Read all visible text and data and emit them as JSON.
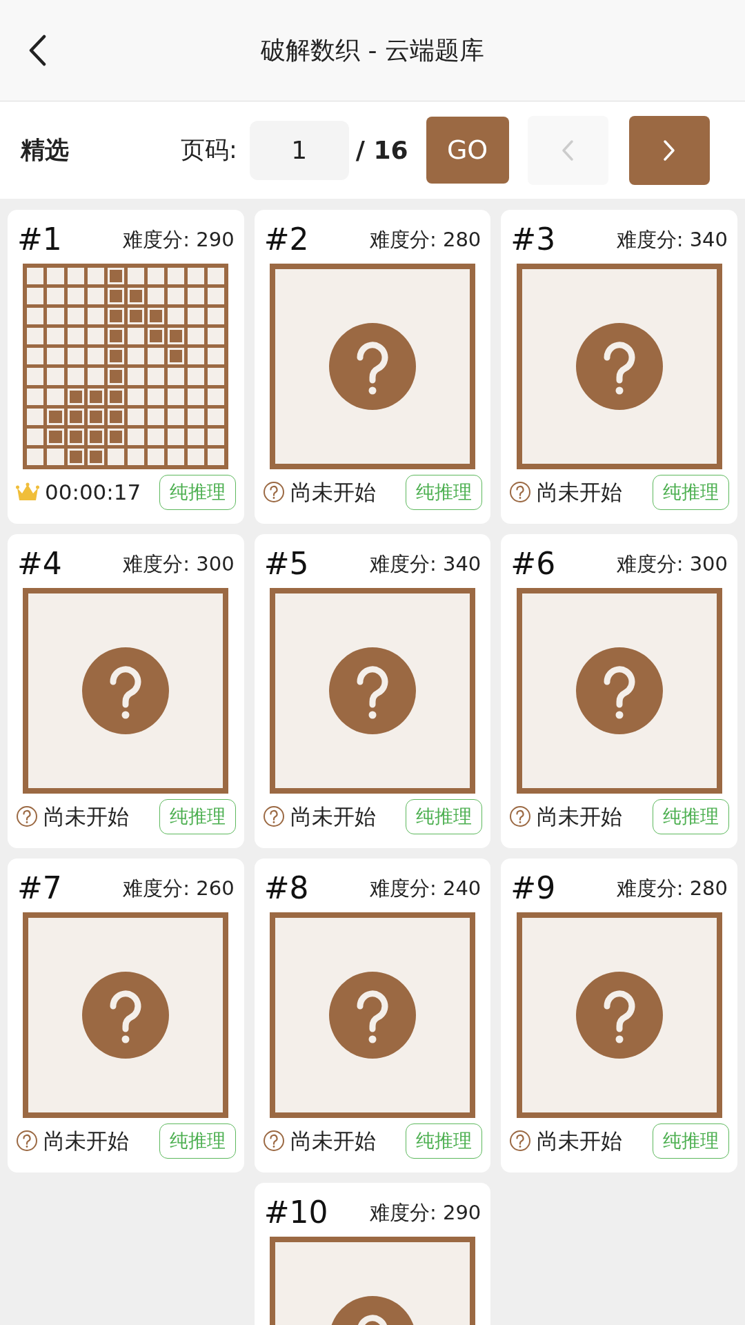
{
  "header": {
    "title": "破解数织 - 云端题库"
  },
  "toolbar": {
    "category": "精选",
    "page_label": "页码:",
    "page_input": {
      "value": "1"
    },
    "page_total": "/ 16",
    "go_button": "GO",
    "prev_button": {
      "disabled": true
    },
    "next_button": {
      "disabled": false
    }
  },
  "puzzles": [
    {
      "number": "#1",
      "difficulty": "难度分: 290",
      "kind": "solved",
      "grid": [
        [
          false,
          false,
          false,
          false,
          true,
          false,
          false,
          false,
          false,
          false
        ],
        [
          false,
          false,
          false,
          false,
          true,
          true,
          false,
          false,
          false,
          false
        ],
        [
          false,
          false,
          false,
          false,
          true,
          true,
          true,
          false,
          false,
          false
        ],
        [
          false,
          false,
          false,
          false,
          true,
          false,
          true,
          true,
          false,
          false
        ],
        [
          false,
          false,
          false,
          false,
          true,
          false,
          false,
          true,
          false,
          false
        ],
        [
          false,
          false,
          false,
          false,
          true,
          false,
          false,
          false,
          false,
          false
        ],
        [
          false,
          false,
          true,
          true,
          true,
          false,
          false,
          false,
          false,
          false
        ],
        [
          false,
          true,
          true,
          true,
          true,
          false,
          false,
          false,
          false,
          false
        ],
        [
          false,
          true,
          true,
          true,
          true,
          false,
          false,
          false,
          false,
          false
        ],
        [
          false,
          false,
          true,
          true,
          false,
          false,
          false,
          false,
          false,
          false
        ]
      ],
      "status": "00:00:17",
      "tag": "纯推理"
    },
    {
      "number": "#2",
      "difficulty": "难度分: 280",
      "kind": "unknown",
      "status": "尚未开始",
      "tag": "纯推理"
    },
    {
      "number": "#3",
      "difficulty": "难度分: 340",
      "kind": "unknown",
      "status": "尚未开始",
      "tag": "纯推理"
    },
    {
      "number": "#4",
      "difficulty": "难度分: 300",
      "kind": "unknown",
      "status": "尚未开始",
      "tag": "纯推理"
    },
    {
      "number": "#5",
      "difficulty": "难度分: 340",
      "kind": "unknown",
      "status": "尚未开始",
      "tag": "纯推理"
    },
    {
      "number": "#6",
      "difficulty": "难度分: 300",
      "kind": "unknown",
      "status": "尚未开始",
      "tag": "纯推理"
    },
    {
      "number": "#7",
      "difficulty": "难度分: 260",
      "kind": "unknown",
      "status": "尚未开始",
      "tag": "纯推理"
    },
    {
      "number": "#8",
      "difficulty": "难度分: 240",
      "kind": "unknown",
      "status": "尚未开始",
      "tag": "纯推理"
    },
    {
      "number": "#9",
      "difficulty": "难度分: 280",
      "kind": "unknown",
      "status": "尚未开始",
      "tag": "纯推理"
    },
    {
      "number": "#10",
      "difficulty": "难度分: 290",
      "kind": "unknown"
    }
  ]
}
